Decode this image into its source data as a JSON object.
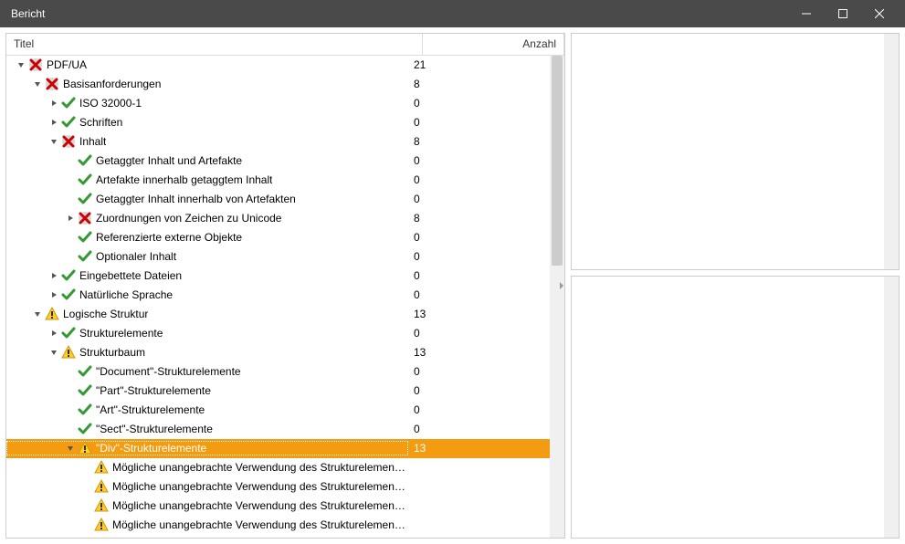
{
  "window": {
    "title": "Bericht"
  },
  "columns": {
    "title": "Titel",
    "count": "Anzahl"
  },
  "tree": [
    {
      "d": 0,
      "exp": "open",
      "ic": "err",
      "t": "PDF/UA",
      "c": "21"
    },
    {
      "d": 1,
      "exp": "open",
      "ic": "err",
      "t": "Basisanforderungen",
      "c": "8"
    },
    {
      "d": 2,
      "exp": "closed",
      "ic": "ok",
      "t": "ISO 32000-1",
      "c": "0"
    },
    {
      "d": 2,
      "exp": "closed",
      "ic": "ok",
      "t": "Schriften",
      "c": "0"
    },
    {
      "d": 2,
      "exp": "open",
      "ic": "err",
      "t": "Inhalt",
      "c": "8"
    },
    {
      "d": 3,
      "exp": "none",
      "ic": "ok",
      "t": "Getaggter Inhalt und Artefakte",
      "c": "0"
    },
    {
      "d": 3,
      "exp": "none",
      "ic": "ok",
      "t": "Artefakte innerhalb getaggtem Inhalt",
      "c": "0"
    },
    {
      "d": 3,
      "exp": "none",
      "ic": "ok",
      "t": "Getaggter Inhalt innerhalb von Artefakten",
      "c": "0"
    },
    {
      "d": 3,
      "exp": "closed",
      "ic": "err",
      "t": "Zuordnungen von Zeichen zu Unicode",
      "c": "8"
    },
    {
      "d": 3,
      "exp": "none",
      "ic": "ok",
      "t": "Referenzierte externe Objekte",
      "c": "0"
    },
    {
      "d": 3,
      "exp": "none",
      "ic": "ok",
      "t": "Optionaler Inhalt",
      "c": "0"
    },
    {
      "d": 2,
      "exp": "closed",
      "ic": "ok",
      "t": "Eingebettete Dateien",
      "c": "0"
    },
    {
      "d": 2,
      "exp": "closed",
      "ic": "ok",
      "t": "Natürliche Sprache",
      "c": "0"
    },
    {
      "d": 1,
      "exp": "open",
      "ic": "warn",
      "t": "Logische Struktur",
      "c": "13"
    },
    {
      "d": 2,
      "exp": "closed",
      "ic": "ok",
      "t": "Strukturelemente",
      "c": "0"
    },
    {
      "d": 2,
      "exp": "open",
      "ic": "warn",
      "t": "Strukturbaum",
      "c": "13"
    },
    {
      "d": 3,
      "exp": "none",
      "ic": "ok",
      "t": "\"Document\"-Strukturelemente",
      "c": "0"
    },
    {
      "d": 3,
      "exp": "none",
      "ic": "ok",
      "t": "\"Part\"-Strukturelemente",
      "c": "0"
    },
    {
      "d": 3,
      "exp": "none",
      "ic": "ok",
      "t": "\"Art\"-Strukturelemente",
      "c": "0"
    },
    {
      "d": 3,
      "exp": "none",
      "ic": "ok",
      "t": "\"Sect\"-Strukturelemente",
      "c": "0"
    },
    {
      "d": 3,
      "exp": "open",
      "ic": "warn",
      "t": "\"Div\"-Strukturelemente",
      "c": "13",
      "sel": true
    },
    {
      "d": 4,
      "exp": "none",
      "ic": "warn",
      "t": "Mögliche unangebrachte Verwendung des Strukturelements \"Div\"",
      "c": ""
    },
    {
      "d": 4,
      "exp": "none",
      "ic": "warn",
      "t": "Mögliche unangebrachte Verwendung des Strukturelements \"Div\"",
      "c": ""
    },
    {
      "d": 4,
      "exp": "none",
      "ic": "warn",
      "t": "Mögliche unangebrachte Verwendung des Strukturelements \"Div\"",
      "c": ""
    },
    {
      "d": 4,
      "exp": "none",
      "ic": "warn",
      "t": "Mögliche unangebrachte Verwendung des Strukturelements \"Div\"",
      "c": ""
    }
  ]
}
